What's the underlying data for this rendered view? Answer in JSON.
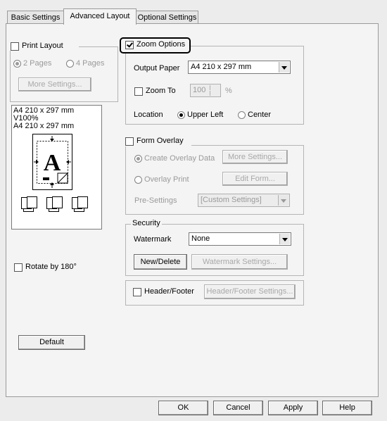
{
  "tabs": [
    {
      "label": "Basic Settings",
      "active": false
    },
    {
      "label": "Advanced Layout",
      "active": true
    },
    {
      "label": "Optional Settings",
      "active": false
    }
  ],
  "print_layout": {
    "label": "Print Layout",
    "checked": false,
    "radio_2pages": "2 Pages",
    "radio_4pages": "4 Pages",
    "more_settings": "More Settings..."
  },
  "preview": {
    "line1": "A4 210 x 297 mm",
    "line2": "V100%",
    "line3": "A4 210 x 297 mm",
    "glyph": "A"
  },
  "rotate": {
    "label": "Rotate by 180°",
    "checked": false
  },
  "default_button": "Default",
  "zoom_options": {
    "label": "Zoom Options",
    "checked": true,
    "output_paper_label": "Output Paper",
    "output_paper_value": "A4 210 x 297 mm",
    "zoom_to_label": "Zoom To",
    "zoom_to_checked": false,
    "zoom_value": "100",
    "zoom_unit": "%",
    "location_label": "Location",
    "location_upper_left": "Upper Left",
    "location_center": "Center",
    "location_selected": "Upper Left"
  },
  "form_overlay": {
    "label": "Form Overlay",
    "checked": false,
    "create_overlay": "Create Overlay Data",
    "more_settings": "More Settings...",
    "overlay_print": "Overlay Print",
    "edit_form": "Edit Form...",
    "pre_settings_label": "Pre-Settings",
    "pre_settings_value": "[Custom Settings]"
  },
  "security": {
    "label": "Security",
    "watermark_label": "Watermark",
    "watermark_value": "None",
    "new_delete": "New/Delete",
    "watermark_settings": "Watermark Settings...",
    "header_footer_label": "Header/Footer",
    "header_footer_checked": false,
    "header_footer_settings": "Header/Footer Settings..."
  },
  "footer_buttons": {
    "ok": "OK",
    "cancel": "Cancel",
    "apply": "Apply",
    "help": "Help"
  }
}
